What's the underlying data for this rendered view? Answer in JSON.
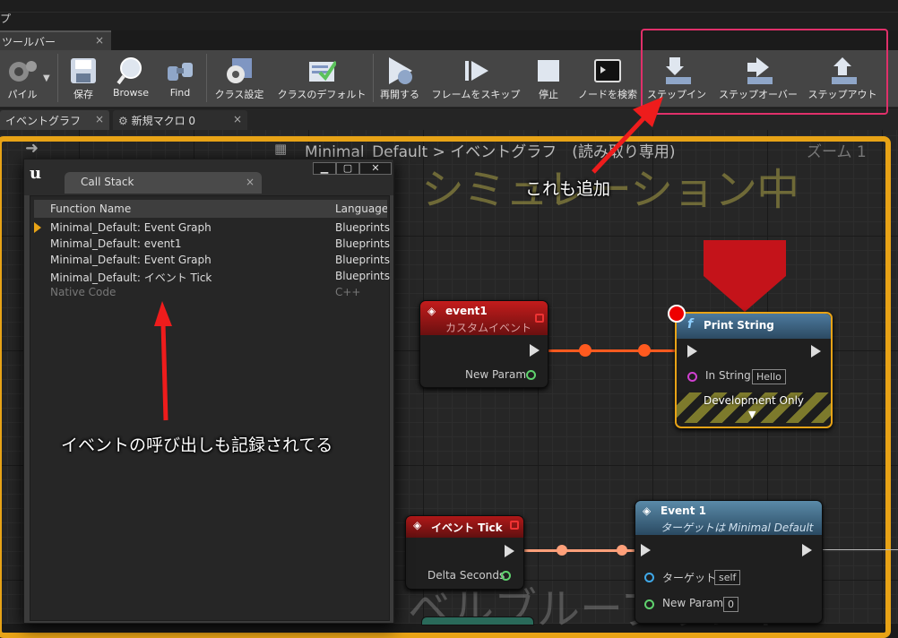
{
  "menubar": {
    "item": "プ"
  },
  "toolbar_tab": {
    "label": "ツールバー"
  },
  "toolbar": {
    "buttons": [
      {
        "label": "パイル",
        "icon": "compile-gear-icon"
      },
      {
        "label": "保存",
        "icon": "save-disk-icon"
      },
      {
        "label": "Browse",
        "icon": "magnifier-icon"
      },
      {
        "label": "Find",
        "icon": "binoculars-icon"
      },
      {
        "label": "クラス設定",
        "icon": "class-settings-gear-icon"
      },
      {
        "label": "クラスのデフォルト",
        "icon": "class-defaults-check-icon"
      },
      {
        "label": "再開する",
        "icon": "resume-play-icon"
      },
      {
        "label": "フレームをスキップ",
        "icon": "skip-frame-icon"
      },
      {
        "label": "停止",
        "icon": "stop-icon"
      },
      {
        "label": "ノードを検索",
        "icon": "find-node-icon"
      },
      {
        "label": "ステップイン",
        "icon": "step-into-icon"
      },
      {
        "label": "ステップオーバー",
        "icon": "step-over-icon"
      },
      {
        "label": "ステップアウト",
        "icon": "step-out-icon"
      }
    ]
  },
  "doc_tabs": [
    {
      "label": "イベントグラフ"
    },
    {
      "label": "新規マクロ 0"
    }
  ],
  "breadcrumb": {
    "path": "Minimal_Default > イベントグラフ　(読み取り専用)",
    "zoom": "ズーム 1"
  },
  "watermarks": {
    "simulation": "シミュレーション中",
    "blueprint": "ベルブループリント"
  },
  "call_stack": {
    "tab_label": "Call Stack",
    "col_function": "Function Name",
    "col_language": "Language",
    "rows": [
      {
        "function": "Minimal_Default: Event Graph",
        "language": "Blueprints",
        "current": true
      },
      {
        "function": "Minimal_Default: event1",
        "language": "Blueprints"
      },
      {
        "function": "Minimal_Default: Event Graph",
        "language": "Blueprints"
      },
      {
        "function": "Minimal_Default: イベント Tick",
        "language": "Blueprints"
      },
      {
        "function": "Native Code",
        "language": "C++",
        "dim": true
      }
    ]
  },
  "nodes": {
    "event1": {
      "title": "event1",
      "subtitle": "カスタムイベント",
      "pin": "New Param"
    },
    "print_string": {
      "title": "Print String",
      "pin_label": "In String",
      "pin_value": "Hello",
      "footer": "Development Only"
    },
    "event_tick": {
      "title": "イベント Tick",
      "pin": "Delta Seconds"
    },
    "event_1_call": {
      "title": "Event 1",
      "subtitle": "ターゲットは Minimal Default",
      "target_label": "ターゲット",
      "target_value": "self",
      "param_label": "New Param",
      "param_value": "0"
    }
  },
  "annotations": {
    "toolbar_note": "これも追加",
    "callstack_note": "イベントの呼び出しも記録されてる"
  },
  "colors": {
    "highlight": "#e0306a",
    "arrow": "#ee1c1c",
    "debug_border": "#e8a316",
    "exec_wire": "#ff5a1f"
  }
}
